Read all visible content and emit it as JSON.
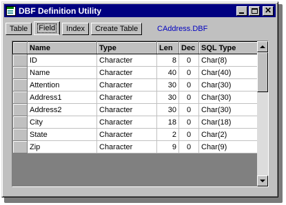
{
  "window": {
    "title": "DBF Definition Utility"
  },
  "tabs": [
    {
      "label": "Table"
    },
    {
      "label": "Field"
    },
    {
      "label": "Index"
    },
    {
      "label": "Create Table"
    }
  ],
  "active_tab": "Field",
  "file_path": "CAddress.DBF",
  "grid": {
    "columns": [
      "Name",
      "Type",
      "Len",
      "Dec",
      "SQL Type"
    ],
    "rows": [
      {
        "name": "ID",
        "type": "Character",
        "len": "8",
        "dec": "0",
        "sql": "Char(8)"
      },
      {
        "name": "Name",
        "type": "Character",
        "len": "40",
        "dec": "0",
        "sql": "Char(40)"
      },
      {
        "name": "Attention",
        "type": "Character",
        "len": "30",
        "dec": "0",
        "sql": "Char(30)"
      },
      {
        "name": "Address1",
        "type": "Character",
        "len": "30",
        "dec": "0",
        "sql": "Char(30)"
      },
      {
        "name": "Address2",
        "type": "Character",
        "len": "30",
        "dec": "0",
        "sql": "Char(30)"
      },
      {
        "name": "City",
        "type": "Character",
        "len": "18",
        "dec": "0",
        "sql": "Char(18)"
      },
      {
        "name": "State",
        "type": "Character",
        "len": "2",
        "dec": "0",
        "sql": "Char(2)"
      },
      {
        "name": "Zip",
        "type": "Character",
        "len": "9",
        "dec": "0",
        "sql": "Char(9)"
      }
    ]
  },
  "icons": {
    "app": "table-app-icon",
    "minimize": "minimize-icon",
    "maximize": "maximize-icon",
    "close": "close-icon",
    "scroll_up": "arrow-up-icon",
    "scroll_down": "arrow-down-icon"
  },
  "colors": {
    "titlebar": "#000080",
    "face": "#c0c0c0",
    "path_text": "#0000c0",
    "grid_empty": "#808080"
  }
}
